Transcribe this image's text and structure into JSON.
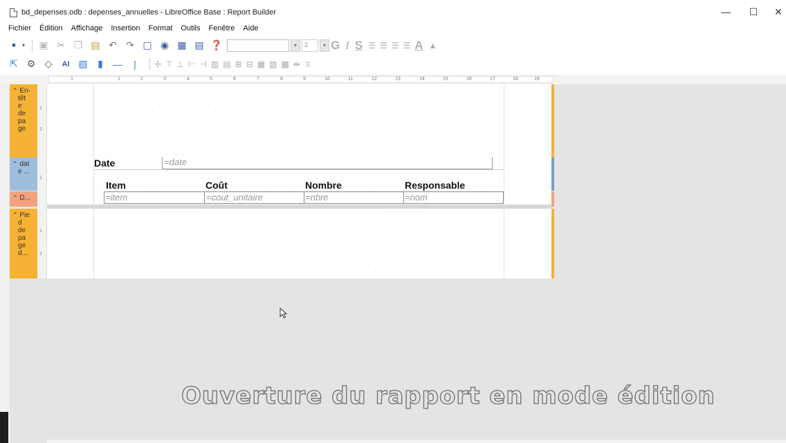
{
  "window": {
    "title": "bd_depenses.odb : depenses_annuelles - LibreOffice Base : Report Builder",
    "minimize": "—",
    "maximize": "☐",
    "close": "✕"
  },
  "menu": [
    "Fichier",
    "Édition",
    "Affichage",
    "Insertion",
    "Format",
    "Outils",
    "Fenêtre",
    "Aide"
  ],
  "toolbar": {
    "font_size": "2",
    "bold": "G",
    "italic": "I",
    "underline": "S"
  },
  "ruler": {
    "numbers": [
      "1",
      "1",
      "2",
      "3",
      "4",
      "5",
      "6",
      "7",
      "8",
      "9",
      "10",
      "11",
      "12",
      "13",
      "14",
      "15",
      "16",
      "17",
      "18",
      "19"
    ]
  },
  "sections": {
    "header": "En-tête de page",
    "header_lines": [
      "En-",
      "têt",
      "e",
      "de",
      "pa",
      "ge"
    ],
    "date_group": "date ...",
    "date_lines": [
      "dat",
      "e ..."
    ],
    "detail": "D...",
    "footer_lines": [
      "Pie",
      "d",
      "de",
      "pa",
      "ge",
      "d..."
    ]
  },
  "report": {
    "date_label": "Date",
    "date_field": "=date",
    "columns": [
      "Item",
      "Coût",
      "Nombre",
      "Responsable"
    ],
    "fields": [
      "=item",
      "=cout_unitaire",
      "=nbre",
      "=nom"
    ]
  },
  "caption": "Ouverture du rapport en mode édition",
  "colors": {
    "section_orange": "#f5b234",
    "section_blue": "#9fbedd",
    "section_salmon": "#f2a37d"
  }
}
